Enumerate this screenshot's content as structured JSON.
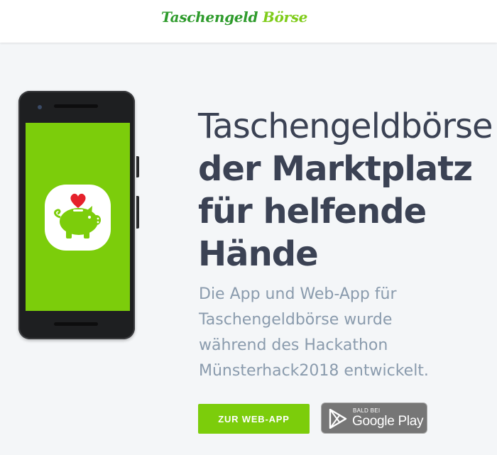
{
  "header": {
    "logo_part1": "Taschengeld",
    "logo_part2": "Börse",
    "logo_color_primary": "#2e9b2c",
    "logo_color_secondary": "#7fcc1a"
  },
  "hero": {
    "title_line1": "Taschengeldbörse",
    "title_line2": "der Marktplatz",
    "title_line3": "für helfende",
    "title_line4": "Hände",
    "desc_line1": "Die App und Web-App für",
    "desc_line2": "Taschengeldbörse wurde",
    "desc_line3": "während des Hackathon",
    "desc_line4": "Münsterhack2018 entwickelt."
  },
  "phone": {
    "screen_color": "#7ccd0b",
    "icon": "piggy-bank-heart-icon"
  },
  "buttons": {
    "webapp_label": "ZUR WEB-APP",
    "play_small": "BALD BEI",
    "play_big": "Google Play",
    "accent": "#7ccd0b"
  }
}
